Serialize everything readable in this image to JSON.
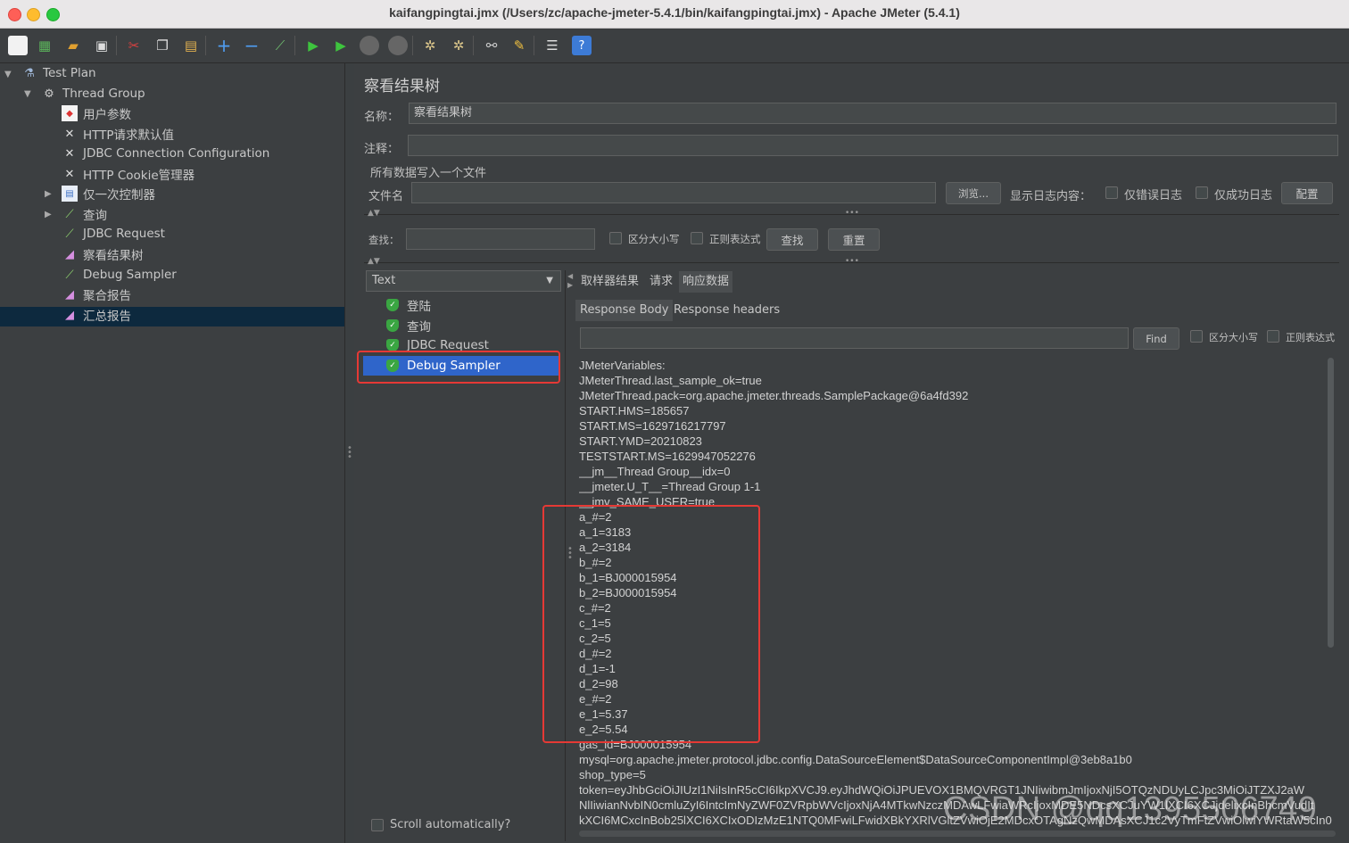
{
  "window": {
    "title": "kaifangpingtai.jmx (/Users/zc/apache-jmeter-5.4.1/bin/kaifangpingtai.jmx) - Apache JMeter (5.4.1)"
  },
  "toolbar": {
    "icons": [
      "new-icon",
      "templates-icon",
      "open-icon",
      "save-icon",
      "cut-icon",
      "copy-icon",
      "paste-icon",
      "expand-icon",
      "collapse-icon",
      "toggle-icon",
      "start-icon",
      "start-no-pauses-icon",
      "stop-icon",
      "shutdown-icon",
      "clear-icon",
      "clear-all-icon",
      "search-icon",
      "reset-search-icon",
      "function-helper-icon",
      "help-icon"
    ]
  },
  "tree": {
    "items": [
      {
        "label": "Test Plan"
      },
      {
        "label": "Thread Group"
      },
      {
        "label": "用户参数"
      },
      {
        "label": "HTTP请求默认值"
      },
      {
        "label": "JDBC Connection Configuration"
      },
      {
        "label": "HTTP Cookie管理器"
      },
      {
        "label": "仅一次控制器"
      },
      {
        "label": "查询"
      },
      {
        "label": "JDBC Request"
      },
      {
        "label": "察看结果树"
      },
      {
        "label": "Debug Sampler"
      },
      {
        "label": "聚合报告"
      },
      {
        "label": "汇总报告"
      }
    ]
  },
  "panel": {
    "title": "察看结果树",
    "name_label": "名称：",
    "name_value": "察看结果树",
    "comment_label": "注释：",
    "comment_value": "",
    "section_label": "所有数据写入一个文件",
    "file_label": "文件名",
    "file_value": "",
    "browse_button": "浏览...",
    "log_label": "显示日志内容：",
    "errors_only": "仅错误日志",
    "success_only": "仅成功日志",
    "configure_button": "配置",
    "search_label": "查找：",
    "search_value": "",
    "case_sensitive": "区分大小写",
    "regex": "正则表达式",
    "find_button": "查找",
    "reset_button": "重置"
  },
  "results": {
    "renderer": "Text",
    "samples": [
      {
        "label": "登陆"
      },
      {
        "label": "查询"
      },
      {
        "label": "JDBC Request"
      },
      {
        "label": "Debug Sampler"
      }
    ],
    "scroll_auto": "Scroll automatically?",
    "tabs": [
      "取样器结果",
      "请求",
      "响应数据"
    ],
    "active_tab": "响应数据",
    "subtabs": [
      "Response Body",
      "Response headers"
    ],
    "find_button": "Find",
    "find_value": "",
    "case_sensitive": "区分大小写",
    "regex": "正则表达式"
  },
  "response_lines": [
    "JMeterVariables:",
    "JMeterThread.last_sample_ok=true",
    "JMeterThread.pack=org.apache.jmeter.threads.SamplePackage@6a4fd392",
    "START.HMS=185657",
    "START.MS=1629716217797",
    "START.YMD=20210823",
    "TESTSTART.MS=1629947052276",
    "__jm__Thread Group__idx=0",
    "__jmeter.U_T__=Thread Group 1-1",
    "__jmv_SAME_USER=true",
    "a_#=2",
    "a_1=3183",
    "a_2=3184",
    "b_#=2",
    "b_1=BJ000015954",
    "b_2=BJ000015954",
    "c_#=2",
    "c_1=5",
    "c_2=5",
    "d_#=2",
    "d_1=-1",
    "d_2=98",
    "e_#=2",
    "e_1=5.37",
    "e_2=5.54",
    "gas_id=BJ000015954",
    "mysql=org.apache.jmeter.protocol.jdbc.config.DataSourceElement$DataSourceComponentImpl@3eb8a1b0",
    "shop_type=5",
    "token=eyJhbGciOiJIUzI1NiIsInR5cCI6IkpXVCJ9.eyJhdWQiOiJPUEVOX1BMQVRGT1JNIiwibmJmIjoxNjI5OTQzNDUyLCJpc3MiOiJTZXJ2aW",
    "NlIiwianNvbIN0cmluZyI6IntcImNyZWF0ZVRpbWVcIjoxNjA4MTkwNzczMDAwLFwiaWRcIjoxMDE5NDcsXCJuYW1lXCI6XCJjdelixcInBhcmVudIt",
    "kXCI6MCxcInBob25lXCI6XCIxODIzMzE1NTQ0MFwiLFwidXBkYXRlVGltZVwiOjE2MDcxOTAgNzQwMDAsXCJ1c2VyTmFtZVwiOlwiYWRtaW5cIn0"
  ],
  "watermark": "CSDN @qq1395506749"
}
